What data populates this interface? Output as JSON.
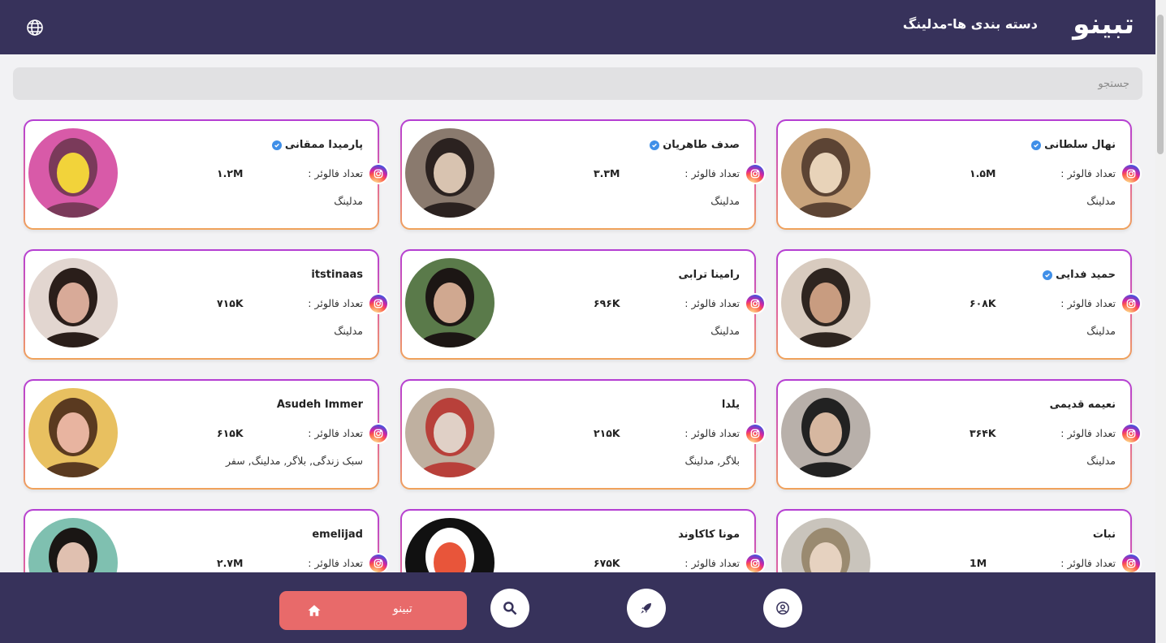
{
  "header": {
    "logo": "تبینو",
    "title": "دسته بندی ها-مدلینگ"
  },
  "search": {
    "placeholder": "جستجو"
  },
  "follower_label": "تعداد فالوئر :",
  "cards": [
    {
      "name": "نهال سلطانی",
      "verified": true,
      "followers": "۱.۵M",
      "category": "مدلینگ",
      "avatar_colors": [
        "#c9a47c",
        "#e8d3b9",
        "#5c4434"
      ]
    },
    {
      "name": "صدف طاهریان",
      "verified": true,
      "followers": "۳.۳M",
      "category": "مدلینگ",
      "avatar_colors": [
        "#8a7a6e",
        "#d8c3b0",
        "#2b2220"
      ]
    },
    {
      "name": "پارمیدا ممقانی",
      "verified": true,
      "followers": "۱.۲M",
      "category": "مدلینگ",
      "avatar_colors": [
        "#d85aa8",
        "#f2d33a",
        "#7a3a5a"
      ]
    },
    {
      "name": "حمید فدایی",
      "verified": true,
      "followers": "۶۰۸K",
      "category": "مدلینگ",
      "avatar_colors": [
        "#d8cbbf",
        "#c89c80",
        "#2e2520"
      ]
    },
    {
      "name": "رامینا ترابی",
      "verified": false,
      "followers": "۶۹۶K",
      "category": "مدلینگ",
      "avatar_colors": [
        "#5a7a4a",
        "#d0a890",
        "#1c1614"
      ]
    },
    {
      "name": "itstinaas",
      "verified": false,
      "followers": "۷۱۵K",
      "category": "مدلینگ",
      "avatar_colors": [
        "#e2d6d0",
        "#d8aa98",
        "#2a1e1a"
      ]
    },
    {
      "name": "نعیمه قدیمی",
      "verified": false,
      "followers": "۳۶۴K",
      "category": "مدلینگ",
      "avatar_colors": [
        "#b8b0aa",
        "#d6b7a0",
        "#222"
      ]
    },
    {
      "name": "یلدا",
      "verified": false,
      "followers": "۲۱۵K",
      "category": "بلاگر, مدلینگ",
      "avatar_colors": [
        "#bfb0a0",
        "#e0d0c6",
        "#b8403a"
      ]
    },
    {
      "name": "Asudeh Immer",
      "verified": false,
      "followers": "۶۱۵K",
      "category": "سبک زندگی, بلاگر, مدلینگ, سفر",
      "avatar_colors": [
        "#e8c060",
        "#e8b4a0",
        "#5a3a20"
      ]
    },
    {
      "name": "نبات",
      "verified": false,
      "followers": "1M",
      "category": "",
      "avatar_colors": [
        "#c9c4bc",
        "#e6d2c0",
        "#9a8a70"
      ]
    },
    {
      "name": "مونا کاکاوند",
      "verified": false,
      "followers": "۶۷۵K",
      "category": "",
      "avatar_colors": [
        "#111111",
        "#e8553a",
        "#ffffff"
      ]
    },
    {
      "name": "emelijad",
      "verified": false,
      "followers": "۲.۷M",
      "category": "",
      "avatar_colors": [
        "#7fc0b0",
        "#e0c0b0",
        "#1a1614"
      ]
    }
  ],
  "bottom_nav": {
    "home_label": "تبینو"
  },
  "colors": {
    "header_bg": "#37325b",
    "accent": "#e86a6a",
    "verified": "#3f8fe8"
  }
}
